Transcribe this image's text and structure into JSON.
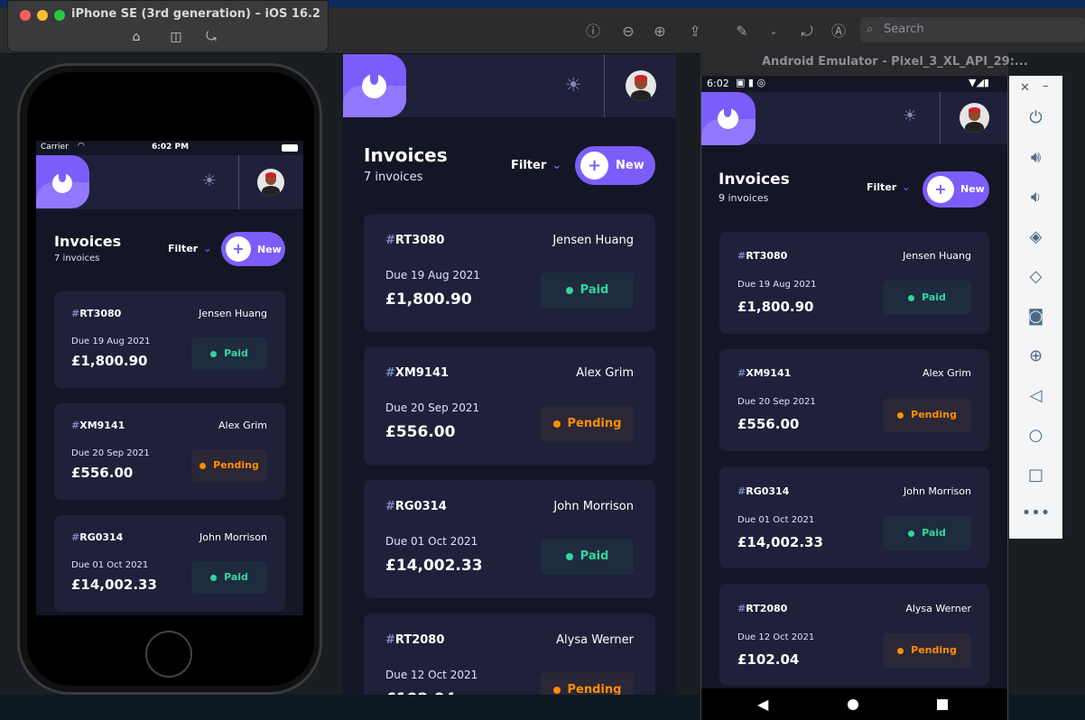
{
  "desktop": {
    "search_placeholder": "Search"
  },
  "simulator": {
    "title": "iPhone SE (3rd generation) – iOS 16.2",
    "status": {
      "carrier": "Carrier",
      "time": "6:02 PM"
    }
  },
  "emulator": {
    "title": "Android Emulator - Pixel_3_XL_API_29:...",
    "status_time": "6:02",
    "side_controls": [
      "power-icon",
      "volume-up-icon",
      "volume-down-icon",
      "rotate-left-icon",
      "rotate-right-icon",
      "camera-icon",
      "zoom-icon",
      "back-icon",
      "home-icon",
      "overview-icon",
      "more-icon"
    ]
  },
  "app": {
    "title": "Invoices",
    "filter_label": "Filter",
    "new_label": "New",
    "web_count": "7 invoices",
    "ios_count": "7 invoices",
    "android_count": "9 invoices",
    "colors": {
      "accent": "#7c5dfa",
      "bg": "#141625",
      "card": "#1e2139",
      "paid": "#33d69f",
      "pending": "#ff8f00"
    },
    "invoices": [
      {
        "hash": "#",
        "id": "RT3080",
        "name": "Jensen Huang",
        "due": "Due 19 Aug 2021",
        "due_web": "Due  19 Aug 2021",
        "amount": "£1,800.90",
        "status": "Paid"
      },
      {
        "hash": "#",
        "id": "XM9141",
        "name": "Alex Grim",
        "due": "Due 20 Sep 2021",
        "due_web": "Due  20 Sep 2021",
        "amount": "£556.00",
        "status": "Pending"
      },
      {
        "hash": "#",
        "id": "RG0314",
        "name": "John Morrison",
        "due": "Due 01 Oct 2021",
        "due_web": "Due  01 Oct 2021",
        "amount": "£14,002.33",
        "status": "Paid"
      },
      {
        "hash": "#",
        "id": "RT2080",
        "name": "Alysa Werner",
        "due": "Due 12 Oct 2021",
        "due_web": "Due  12 Oct 2021",
        "amount": "£102.04",
        "status": "Pending"
      }
    ]
  }
}
